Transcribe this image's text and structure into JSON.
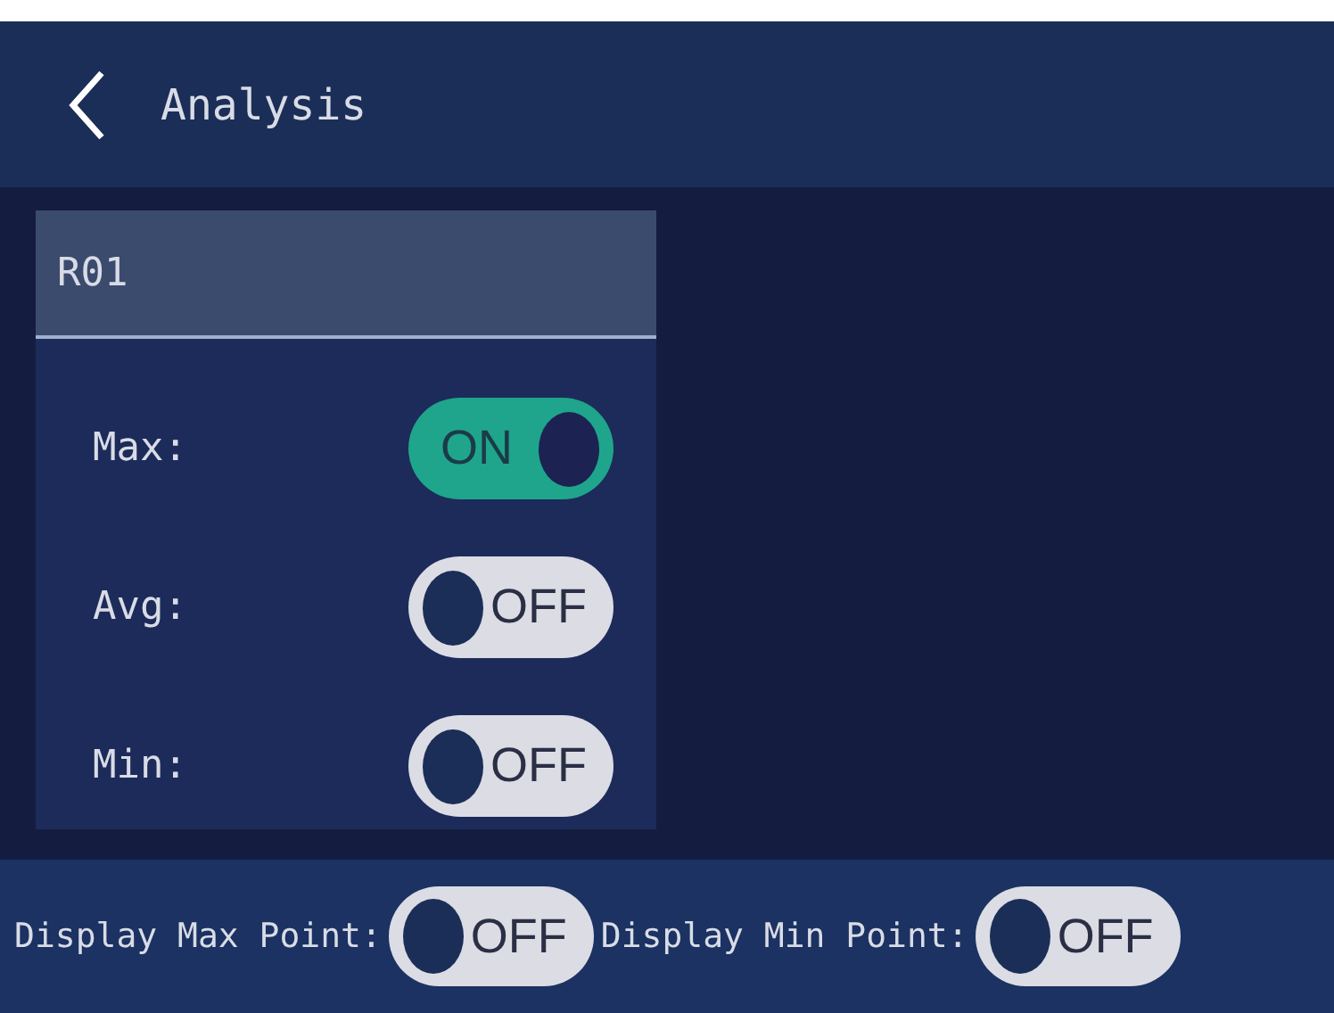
{
  "header": {
    "title": "Analysis"
  },
  "panel": {
    "title": "R01",
    "rows": [
      {
        "label": "Max:",
        "toggle": "ON",
        "on": true
      },
      {
        "label": "Avg:",
        "toggle": "OFF",
        "on": false
      },
      {
        "label": "Min:",
        "toggle": "OFF",
        "on": false
      }
    ]
  },
  "bottom": [
    {
      "label": "Display Max Point:",
      "toggle": "OFF",
      "on": false
    },
    {
      "label": "Display Min Point:",
      "toggle": "OFF",
      "on": false
    }
  ]
}
